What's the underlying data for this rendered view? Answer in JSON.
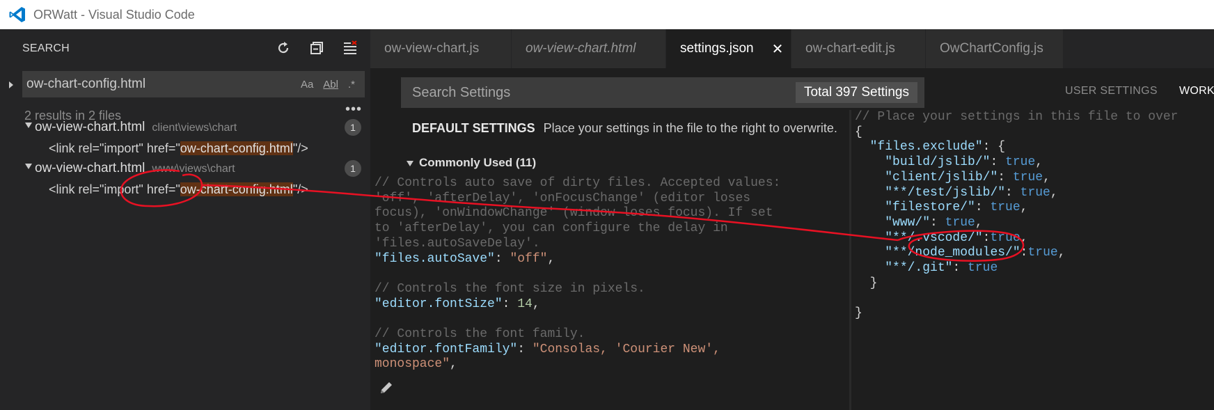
{
  "window": {
    "title": "ORWatt - Visual Studio Code"
  },
  "sidebar": {
    "title": "SEARCH",
    "icons": [
      "refresh-icon",
      "collapse-all-icon",
      "clear-results-icon"
    ],
    "search": {
      "value": "ow-chart-config.html",
      "options": {
        "match_case": "Aa",
        "whole_word": "Abl",
        "regex": ".*"
      }
    },
    "more": "•••",
    "results_count": "2 results in 2 files",
    "results": [
      {
        "file": "ow-view-chart.html",
        "path": "client\\views\\chart",
        "count": "1",
        "match_before": "<link rel=\"import\" href=\"",
        "match_hl": "ow-chart-config.html",
        "match_after": "\"/>"
      },
      {
        "file": "ow-view-chart.html",
        "path": "www\\views\\chart",
        "count": "1",
        "match_before": "<link rel=\"import\" href=\"",
        "match_hl": "ow-chart-config.html",
        "match_after": "\"/>"
      }
    ]
  },
  "tabs": [
    {
      "label": "ow-view-chart.js",
      "italic": false,
      "active": false
    },
    {
      "label": "ow-view-chart.html",
      "italic": true,
      "active": false
    },
    {
      "label": "settings.json",
      "italic": false,
      "active": true,
      "close": "✕"
    },
    {
      "label": "ow-chart-edit.js",
      "italic": false,
      "active": false
    },
    {
      "label": "OwChartConfig.js",
      "italic": false,
      "active": false
    }
  ],
  "settings": {
    "search_placeholder": "Search Settings",
    "total": "Total 397 Settings",
    "user_tab": "USER SETTINGS",
    "workspace_tab": "WORK",
    "default_heading": "DEFAULT SETTINGS",
    "default_hint": "Place your settings in the file to the right to overwrite.",
    "commonly_used": "Commonly Used (11)",
    "default_lines": [
      {
        "t": "cmt",
        "text": "// Controls auto save of dirty files. Accepted values:"
      },
      {
        "t": "cmt",
        "text": "'off', 'afterDelay', 'onFocusChange' (editor loses"
      },
      {
        "t": "cmt",
        "text": "focus), 'onWindowChange' (window loses focus). If set"
      },
      {
        "t": "cmt",
        "text": "to 'afterDelay', you can configure the delay in"
      },
      {
        "t": "cmt",
        "text": "'files.autoSaveDelay'."
      },
      {
        "t": "kv",
        "key": "\"files.autoSave\"",
        "sep": ": ",
        "val": "\"off\"",
        "vt": "str",
        "end": ","
      },
      {
        "t": "blank",
        "text": ""
      },
      {
        "t": "cmt",
        "text": "// Controls the font size in pixels."
      },
      {
        "t": "kv",
        "key": "\"editor.fontSize\"",
        "sep": ": ",
        "val": "14",
        "vt": "num",
        "end": ","
      },
      {
        "t": "blank",
        "text": ""
      },
      {
        "t": "cmt",
        "text": "// Controls the font family."
      },
      {
        "t": "kv",
        "key": "\"editor.fontFamily\"",
        "sep": ": ",
        "val": "\"Consolas, 'Courier New',",
        "vt": "str",
        "end": ""
      },
      {
        "t": "strline",
        "text": "monospace\"",
        "end": ","
      }
    ],
    "workspace_lines": [
      {
        "t": "cmt",
        "text": "// Place your settings in this file to over"
      },
      {
        "t": "pun",
        "text": "{"
      },
      {
        "t": "kv",
        "indent": "  ",
        "key": "\"files.exclude\"",
        "sep": ": ",
        "val": "{",
        "vt": "pun",
        "end": ""
      },
      {
        "t": "kv",
        "indent": "    ",
        "key": "\"build/jslib/\"",
        "sep": ": ",
        "val": "true",
        "vt": "kw",
        "end": ","
      },
      {
        "t": "kv",
        "indent": "    ",
        "key": "\"client/jslib/\"",
        "sep": ": ",
        "val": "true",
        "vt": "kw",
        "end": ","
      },
      {
        "t": "kv",
        "indent": "    ",
        "key": "\"**/test/jslib/\"",
        "sep": ": ",
        "val": "true",
        "vt": "kw",
        "end": ","
      },
      {
        "t": "kv",
        "indent": "    ",
        "key": "\"filestore/\"",
        "sep": ": ",
        "val": "true",
        "vt": "kw",
        "end": ","
      },
      {
        "t": "kv",
        "indent": "    ",
        "key": "\"www/\"",
        "sep": ": ",
        "val": "true",
        "vt": "kw",
        "end": ","
      },
      {
        "t": "kv",
        "indent": "    ",
        "key": "\"**/.vscode/\"",
        "sep": ":",
        "val": "true",
        "vt": "kw",
        "end": ","
      },
      {
        "t": "kv",
        "indent": "    ",
        "key": "\"**/node_modules/\"",
        "sep": ":",
        "val": "true",
        "vt": "kw",
        "end": ","
      },
      {
        "t": "kv",
        "indent": "    ",
        "key": "\"**/.git\"",
        "sep": ": ",
        "val": "true",
        "vt": "kw",
        "end": ""
      },
      {
        "t": "pun",
        "text": "  }"
      },
      {
        "t": "blank",
        "text": ""
      },
      {
        "t": "pun",
        "text": "}"
      }
    ]
  },
  "colors": {
    "annotation": "#e81123",
    "highlight": "#613214",
    "accent_blue": "#007acc"
  }
}
